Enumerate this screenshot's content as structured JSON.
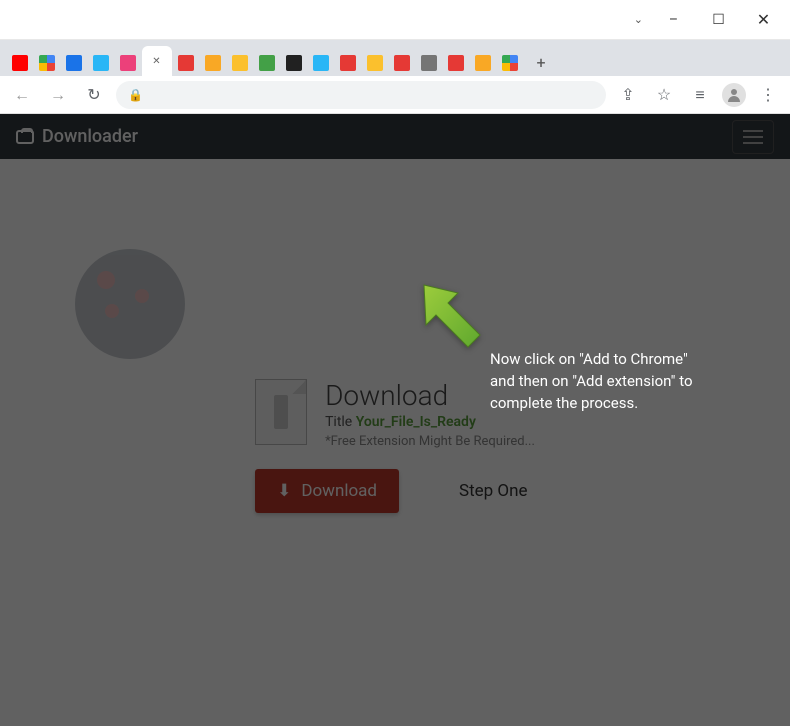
{
  "window": {
    "minimize": "–",
    "maximize": "☐",
    "close": "✕"
  },
  "tabs": {
    "newtab": "+",
    "close": "✕",
    "dropdown": "⌄"
  },
  "toolbar": {
    "back": "←",
    "forward": "→",
    "reload": "↻",
    "share": "⇪",
    "star": "☆",
    "list": "≡",
    "menu": "⋮"
  },
  "header": {
    "brand": "Downloader"
  },
  "page": {
    "download_heading": "Download",
    "title_prefix": "Title ",
    "filename": "Your_File_Is_Ready",
    "note": "*Free Extension Might Be Required...",
    "download_button": "Download",
    "step": "Step One"
  },
  "tooltip": "Now click on \"Add to Chrome\" and then on \"Add extension\" to complete the process.",
  "colors": {
    "favicons": [
      "#ff0000",
      "#4285f4",
      "#1a73e8",
      "#29b6f6",
      "#ec407a",
      "#ffffff",
      "#e53935",
      "#f9a825",
      "#fbc02d",
      "#43a047",
      "#212121",
      "#29b6f6",
      "#e53935",
      "#fbc02d",
      "#e53935",
      "#757575",
      "#e53935",
      "#f9a825",
      "#4285f4"
    ]
  }
}
